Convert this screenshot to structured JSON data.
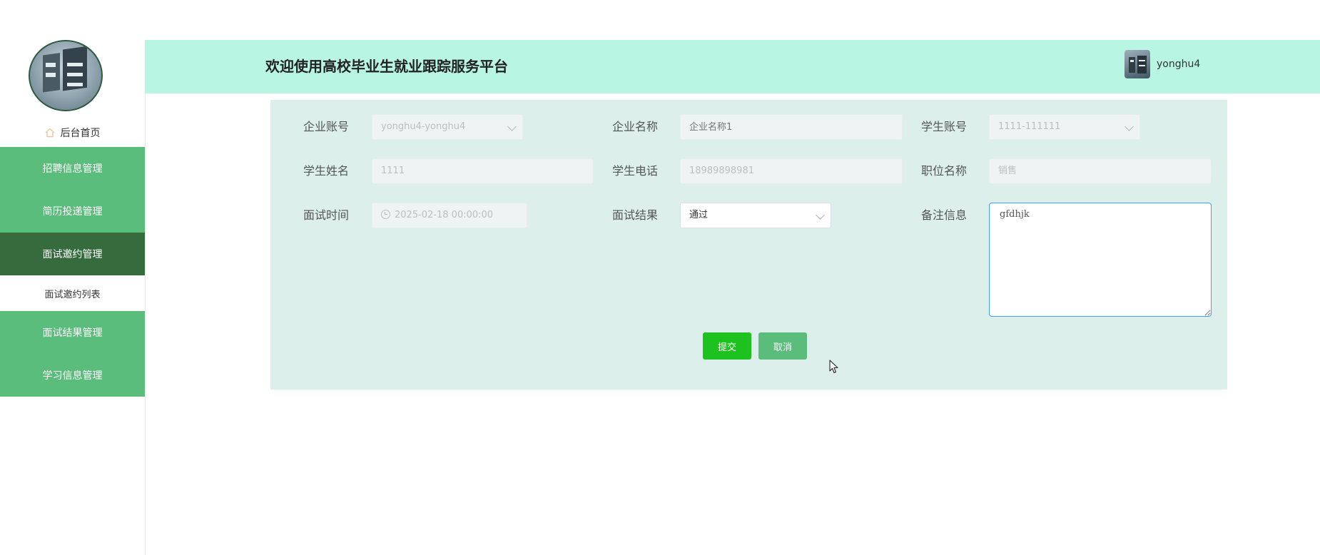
{
  "header": {
    "title": "欢迎使用高校毕业生就业跟踪服务平台",
    "username": "yonghu4"
  },
  "sidebar": {
    "home_label": "后台首页",
    "menu": [
      {
        "label": "招聘信息管理"
      },
      {
        "label": "简历投递管理"
      },
      {
        "label": "面试邀约管理"
      },
      {
        "label": "面试邀约列表"
      },
      {
        "label": "面试结果管理"
      },
      {
        "label": "学习信息管理"
      }
    ]
  },
  "form": {
    "company_account": {
      "label": "企业账号",
      "value": "yonghu4-yonghu4"
    },
    "company_name": {
      "label": "企业名称",
      "placeholder": "企业名称1"
    },
    "student_account": {
      "label": "学生账号",
      "value": "1111-111111"
    },
    "student_name": {
      "label": "学生姓名",
      "value": "1111"
    },
    "student_phone": {
      "label": "学生电话",
      "value": "18989898981"
    },
    "position_name": {
      "label": "职位名称",
      "value": "销售"
    },
    "interview_time": {
      "label": "面试时间",
      "value": "2025-02-18 00:00:00"
    },
    "interview_result": {
      "label": "面试结果",
      "value": "通过"
    },
    "remark": {
      "label": "备注信息",
      "value": "gfdhjk"
    },
    "submit_label": "提交",
    "cancel_label": "取消"
  },
  "colors": {
    "header_bg": "#b8f6e3",
    "menu_bg": "#5bbd7c",
    "menu_active_bg": "#356b3d",
    "card_bg": "#dcefeb",
    "submit_bg": "#1ec21e",
    "focus_border": "#409eff"
  },
  "icons": {
    "home": "home-icon",
    "clock": "clock-icon",
    "chevron": "chevron-down-icon"
  }
}
